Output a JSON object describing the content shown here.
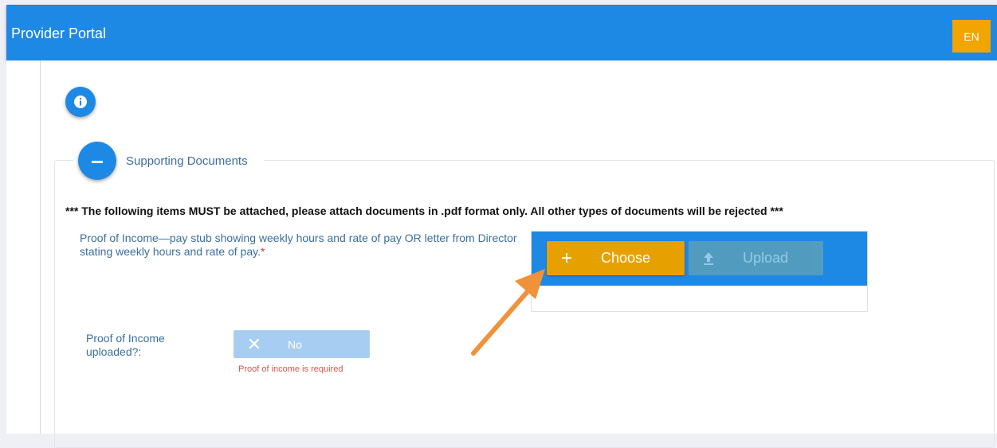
{
  "header": {
    "title": "Provider Portal",
    "language_label": "EN"
  },
  "section": {
    "title": "Supporting Documents",
    "notice": "*** The following items MUST be attached, please attach documents in .pdf format only. All other types of documents will be rejected ***"
  },
  "proof_of_income": {
    "label": "Proof of Income—pay stub showing weekly hours and rate of pay OR letter from Director stating weekly hours and rate of pay.",
    "required_mark": "*",
    "choose_label": "Choose",
    "upload_label": "Upload",
    "uploaded_question": "Proof of Income uploaded?:",
    "uploaded_value": "No",
    "error": "Proof of income is required"
  },
  "colors": {
    "header": "#1e88e5",
    "accent": "#e6a100",
    "annotation_arrow": "#f0923a"
  },
  "icons": [
    "info-icon",
    "minus-icon",
    "plus-icon",
    "upload-icon",
    "close-icon"
  ]
}
